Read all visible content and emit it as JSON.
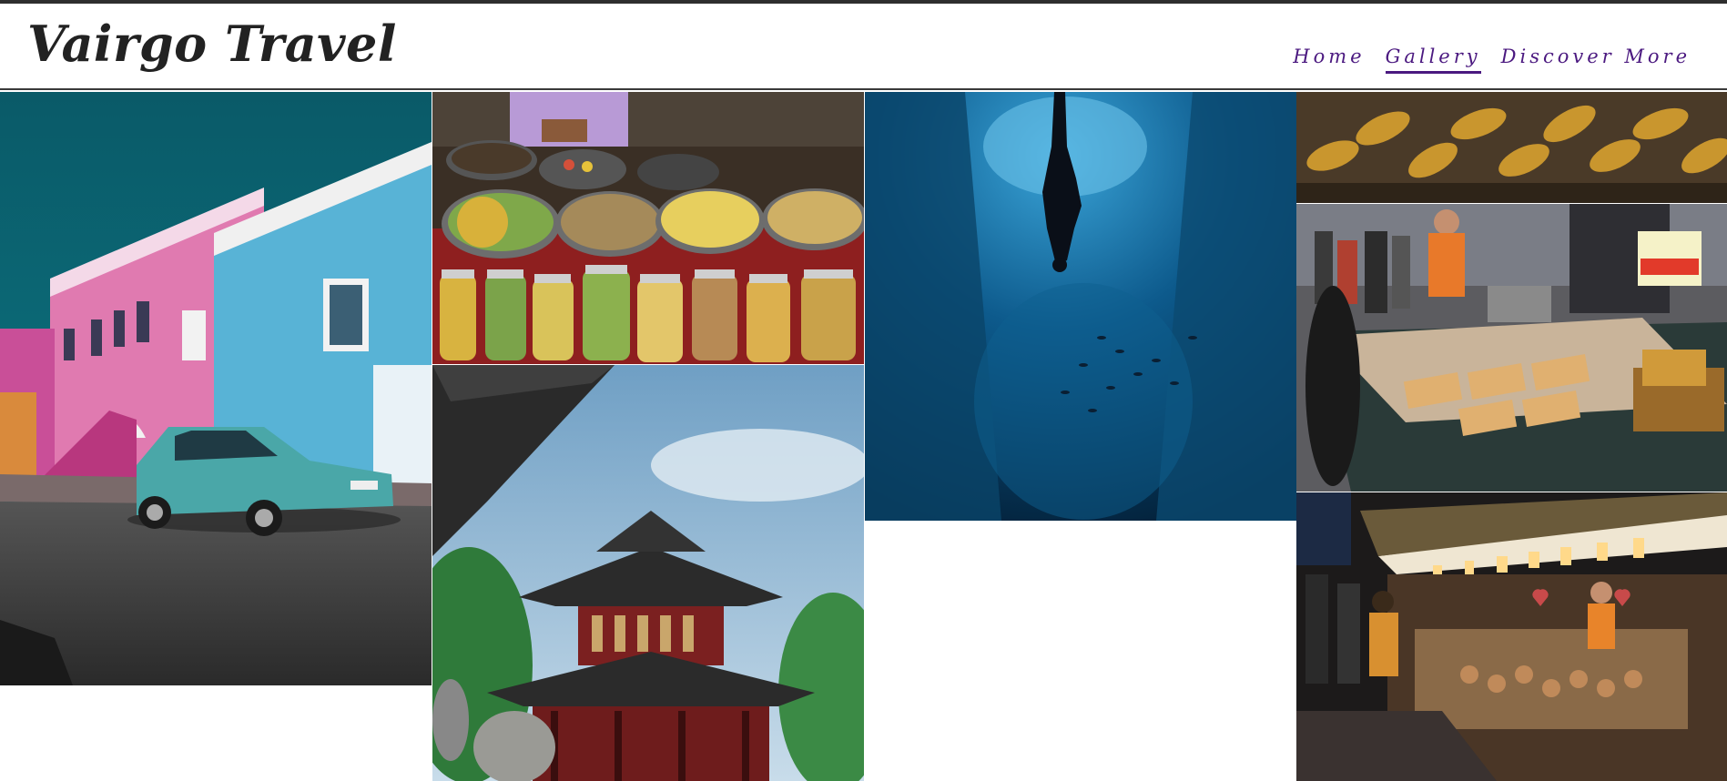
{
  "header": {
    "brand": "Vairgo Travel",
    "nav": [
      {
        "label": "Home",
        "active": false
      },
      {
        "label": "Gallery",
        "active": true
      },
      {
        "label": "Discover More",
        "active": false
      }
    ]
  },
  "colors": {
    "nav_text": "#4b1980",
    "brand_text": "#222222",
    "header_border": "#3a3a3a"
  },
  "gallery": {
    "photos": [
      {
        "id": "colorful-houses",
        "subject": "pink and blue houses with teal car"
      },
      {
        "id": "spice-market",
        "subject": "market bowls and jars of grains"
      },
      {
        "id": "pagoda",
        "subject": "traditional pagoda with trees"
      },
      {
        "id": "freediver",
        "subject": "freediver underwater in blue cave"
      },
      {
        "id": "corn-cobs",
        "subject": "roasted corn cobs"
      },
      {
        "id": "street-food-stall",
        "subject": "street food market stall"
      },
      {
        "id": "night-market",
        "subject": "night market stall with lanterns"
      }
    ]
  }
}
